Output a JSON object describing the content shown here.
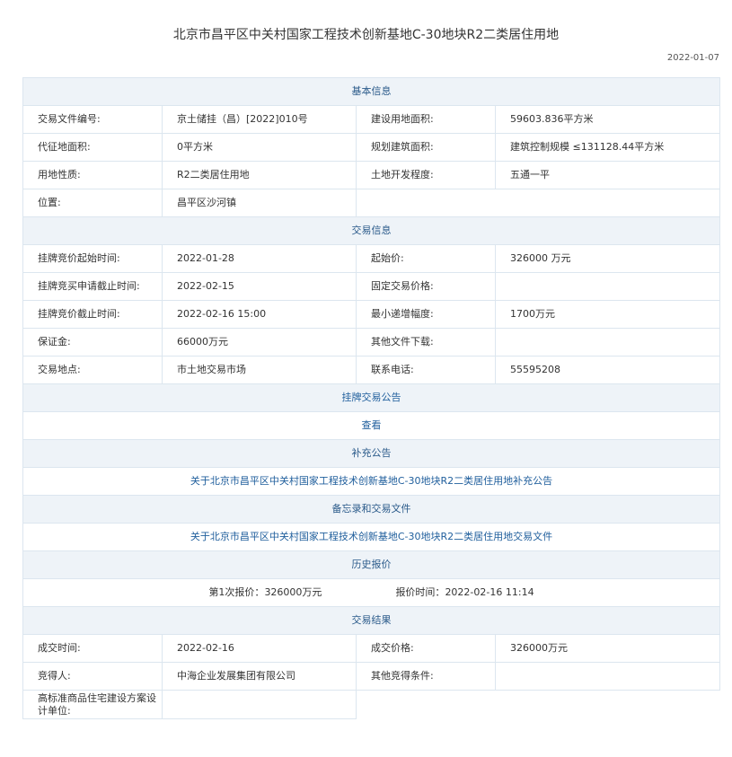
{
  "page": {
    "title": "北京市昌平区中关村国家工程技术创新基地C-30地块R2二类居住用地",
    "date": "2022-01-07"
  },
  "basic": {
    "header": "基本信息",
    "rows": [
      [
        {
          "k": "交易文件编号:",
          "v": "京土储挂（昌）[2022]010号"
        },
        {
          "k": "建设用地面积:",
          "v": "59603.836平方米"
        }
      ],
      [
        {
          "k": "代征地面积:",
          "v": "0平方米"
        },
        {
          "k": "规划建筑面积:",
          "v": "建筑控制规模 ≤131128.44平方米"
        }
      ],
      [
        {
          "k": "用地性质:",
          "v": "R2二类居住用地"
        },
        {
          "k": "土地开发程度:",
          "v": "五通一平"
        }
      ],
      [
        {
          "k": "位置:",
          "v": "昌平区沙河镇"
        }
      ]
    ]
  },
  "trade": {
    "header": "交易信息",
    "rows": [
      [
        {
          "k": "挂牌竞价起始时间:",
          "v": "2022-01-28"
        },
        {
          "k": "起始价:",
          "v": "326000 万元"
        }
      ],
      [
        {
          "k": "挂牌竞买申请截止时间:",
          "v": "2022-02-15"
        },
        {
          "k": "固定交易价格:",
          "v": ""
        }
      ],
      [
        {
          "k": "挂牌竞价截止时间:",
          "v": "2022-02-16 15:00"
        },
        {
          "k": "最小递增幅度:",
          "v": "1700万元"
        }
      ],
      [
        {
          "k": "保证金:",
          "v": "66000万元"
        },
        {
          "k": "其他文件下载:",
          "v": ""
        }
      ],
      [
        {
          "k": "交易地点:",
          "v": "市土地交易市场"
        },
        {
          "k": "联系电话:",
          "v": "55595208"
        }
      ]
    ]
  },
  "announcement": {
    "header": "挂牌交易公告",
    "view_link": "查看"
  },
  "supplement": {
    "header": "补充公告",
    "link": "关于北京市昌平区中关村国家工程技术创新基地C-30地块R2二类居住用地补充公告"
  },
  "memo": {
    "header": "备忘录和交易文件",
    "link": "关于北京市昌平区中关村国家工程技术创新基地C-30地块R2二类居住用地交易文件"
  },
  "history": {
    "header": "历史报价",
    "entry_label": "第1次报价：",
    "entry_price": "326000万元",
    "time_label": "报价时间：",
    "time_value": "2022-02-16 11:14"
  },
  "result": {
    "header": "交易结果",
    "rows": [
      [
        {
          "k": "成交时间:",
          "v": "2022-02-16"
        },
        {
          "k": "成交价格:",
          "v": "326000万元"
        }
      ],
      [
        {
          "k": "竞得人:",
          "v": "中海企业发展集团有限公司"
        },
        {
          "k": "其他竞得条件:",
          "v": ""
        }
      ],
      [
        {
          "k": "高标准商品住宅建设方案设计单位:",
          "v": ""
        }
      ]
    ]
  },
  "colors": {
    "section_bg": "#eef3f8",
    "section_text": "#2a5a8a",
    "link": "#1f5e9c",
    "border": "#dce6ef"
  }
}
